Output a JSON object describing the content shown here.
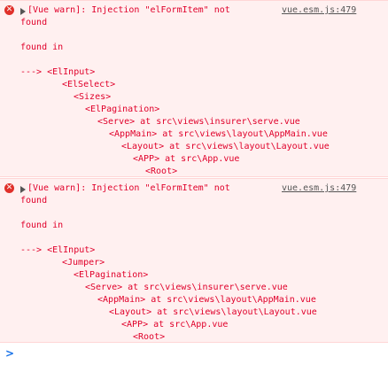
{
  "messages": [
    {
      "text": "[Vue warn]: Injection \"elFormItem\" not",
      "continuation": "found",
      "source": "vue.esm.js:479",
      "found_in": "found in",
      "trace": [
        "---> <ElInput>",
        "<ElSelect>",
        "<Sizes>",
        "<ElPagination>",
        "<Serve> at src\\views\\insurer\\serve.vue",
        "<AppMain> at src\\views\\layout\\AppMain.vue",
        "<Layout> at src\\views\\layout\\Layout.vue",
        "<APP> at src\\App.vue",
        "<Root>"
      ]
    },
    {
      "text": "[Vue warn]: Injection \"elFormItem\" not",
      "continuation": "found",
      "source": "vue.esm.js:479",
      "found_in": "found in",
      "trace": [
        "---> <ElInput>",
        "<Jumper>",
        "<ElPagination>",
        "<Serve> at src\\views\\insurer\\serve.vue",
        "<AppMain> at src\\views\\layout\\AppMain.vue",
        "<Layout> at src\\views\\layout\\Layout.vue",
        "<APP> at src\\App.vue",
        "<Root>"
      ]
    }
  ],
  "console": {
    "prompt_symbol": ">",
    "error_icon": "error-circle-icon",
    "expand_icon": "expand-triangle-icon"
  }
}
